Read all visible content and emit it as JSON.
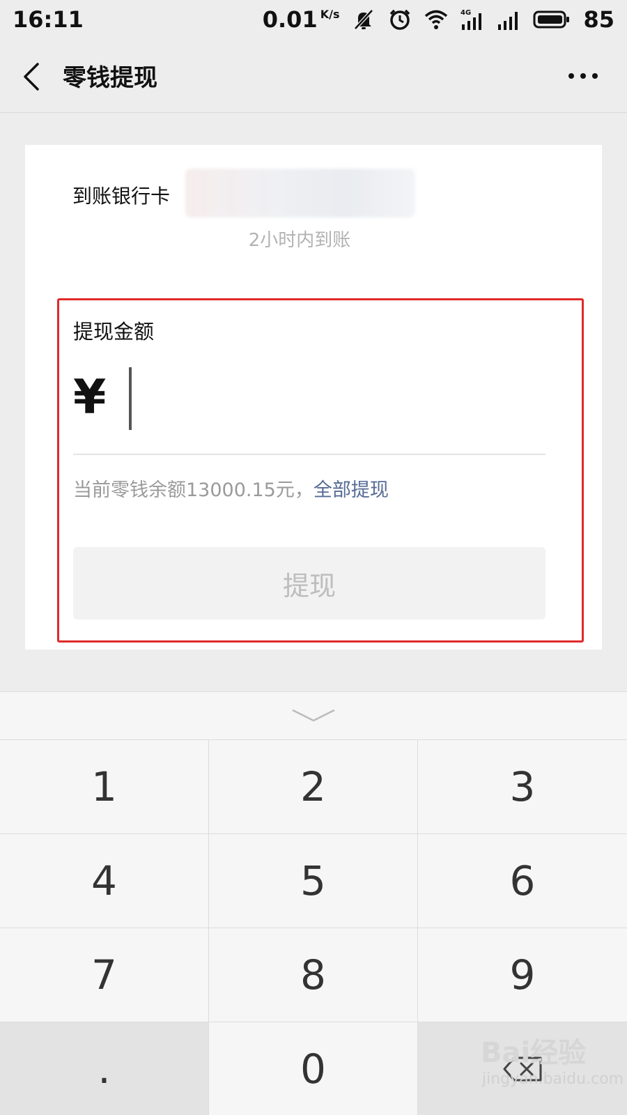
{
  "status_bar": {
    "time": "16:11",
    "net_speed": "0.01",
    "net_unit": "K/s",
    "battery": "85",
    "icons": [
      "mute-icon",
      "alarm-icon",
      "wifi-icon",
      "signal-4g-icon",
      "signal-icon",
      "battery-icon"
    ]
  },
  "nav": {
    "title": "零钱提现",
    "back_icon": "chevron-left-icon",
    "more_icon": "more-dots-icon"
  },
  "card": {
    "bank_label": "到账银行卡",
    "arrival_note": "2小时内到账"
  },
  "amount": {
    "label": "提现金额",
    "currency": "¥",
    "value": "",
    "balance_text": "当前零钱余额13000.15元，",
    "withdraw_all": "全部提现",
    "submit_label": "提现"
  },
  "keypad": {
    "keys": [
      "1",
      "2",
      "3",
      "4",
      "5",
      "6",
      "7",
      "8",
      "9",
      ".",
      "0"
    ],
    "collapse_icon": "chevron-down-icon",
    "backspace_icon": "backspace-icon"
  },
  "watermark": {
    "logo": "Bai经验",
    "url": "jingyan.baidu.com"
  },
  "colors": {
    "highlight_border": "#e02a2a",
    "link": "#576b95",
    "background": "#ededed"
  }
}
